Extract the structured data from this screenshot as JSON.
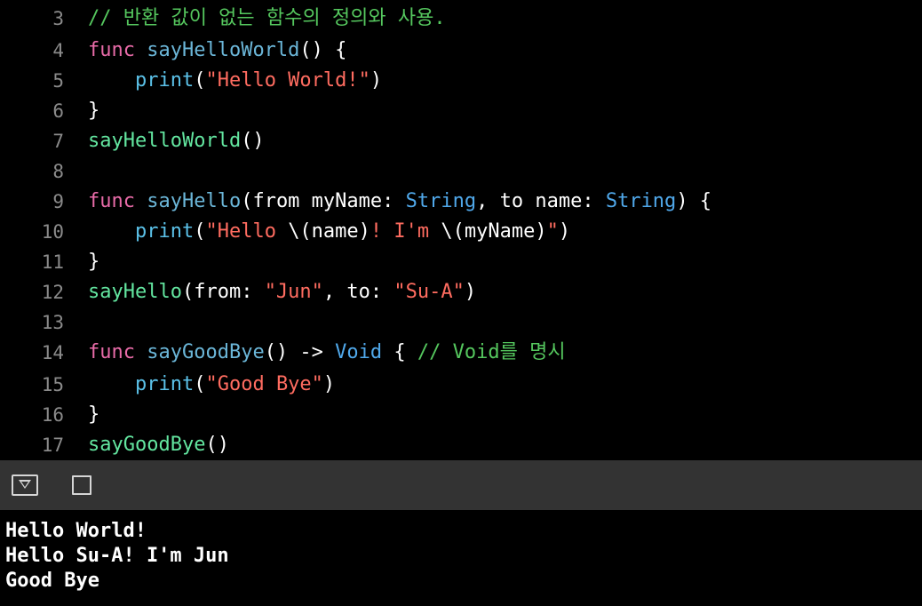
{
  "editor": {
    "lines": [
      {
        "number": "3",
        "tokens": [
          {
            "t": "// 반환 값이 없는 함수의 정의와 사용.",
            "k": "comment"
          }
        ]
      },
      {
        "number": "4",
        "tokens": [
          {
            "t": "func",
            "k": "keyword"
          },
          {
            "t": " ",
            "k": "plain"
          },
          {
            "t": "sayHelloWorld",
            "k": "decl"
          },
          {
            "t": "() {",
            "k": "plain"
          }
        ]
      },
      {
        "number": "5",
        "tokens": [
          {
            "t": "    ",
            "k": "plain"
          },
          {
            "t": "print",
            "k": "call"
          },
          {
            "t": "(",
            "k": "plain"
          },
          {
            "t": "\"Hello World!\"",
            "k": "string"
          },
          {
            "t": ")",
            "k": "plain"
          }
        ]
      },
      {
        "number": "6",
        "tokens": [
          {
            "t": "}",
            "k": "plain"
          }
        ]
      },
      {
        "number": "7",
        "tokens": [
          {
            "t": "sayHelloWorld",
            "k": "fn"
          },
          {
            "t": "()",
            "k": "plain"
          }
        ]
      },
      {
        "number": "8",
        "tokens": []
      },
      {
        "number": "9",
        "tokens": [
          {
            "t": "func",
            "k": "keyword"
          },
          {
            "t": " ",
            "k": "plain"
          },
          {
            "t": "sayHello",
            "k": "decl"
          },
          {
            "t": "(from myName: ",
            "k": "plain"
          },
          {
            "t": "String",
            "k": "type"
          },
          {
            "t": ", to name: ",
            "k": "plain"
          },
          {
            "t": "String",
            "k": "type"
          },
          {
            "t": ") {",
            "k": "plain"
          }
        ]
      },
      {
        "number": "10",
        "tokens": [
          {
            "t": "    ",
            "k": "plain"
          },
          {
            "t": "print",
            "k": "call"
          },
          {
            "t": "(",
            "k": "plain"
          },
          {
            "t": "\"Hello ",
            "k": "string"
          },
          {
            "t": "\\(name)",
            "k": "plain"
          },
          {
            "t": "! I'm ",
            "k": "string"
          },
          {
            "t": "\\(myName)",
            "k": "plain"
          },
          {
            "t": "\"",
            "k": "string"
          },
          {
            "t": ")",
            "k": "plain"
          }
        ]
      },
      {
        "number": "11",
        "tokens": [
          {
            "t": "}",
            "k": "plain"
          }
        ]
      },
      {
        "number": "12",
        "tokens": [
          {
            "t": "sayHello",
            "k": "fn"
          },
          {
            "t": "(from: ",
            "k": "plain"
          },
          {
            "t": "\"Jun\"",
            "k": "string"
          },
          {
            "t": ", to: ",
            "k": "plain"
          },
          {
            "t": "\"Su-A\"",
            "k": "string"
          },
          {
            "t": ")",
            "k": "plain"
          }
        ]
      },
      {
        "number": "13",
        "tokens": []
      },
      {
        "number": "14",
        "tokens": [
          {
            "t": "func",
            "k": "keyword"
          },
          {
            "t": " ",
            "k": "plain"
          },
          {
            "t": "sayGoodBye",
            "k": "decl"
          },
          {
            "t": "() -> ",
            "k": "plain"
          },
          {
            "t": "Void",
            "k": "type"
          },
          {
            "t": " { ",
            "k": "plain"
          },
          {
            "t": "// Void를 명시",
            "k": "comment"
          }
        ]
      },
      {
        "number": "15",
        "tokens": [
          {
            "t": "    ",
            "k": "plain"
          },
          {
            "t": "print",
            "k": "call"
          },
          {
            "t": "(",
            "k": "plain"
          },
          {
            "t": "\"Good Bye\"",
            "k": "string"
          },
          {
            "t": ")",
            "k": "plain"
          }
        ]
      },
      {
        "number": "16",
        "tokens": [
          {
            "t": "}",
            "k": "plain"
          }
        ]
      },
      {
        "number": "17",
        "tokens": [
          {
            "t": "sayGoodBye",
            "k": "fn"
          },
          {
            "t": "()",
            "k": "plain"
          }
        ]
      }
    ]
  },
  "toolbar": {
    "hide_console_icon": "hide-debug-area-icon",
    "clear_console_icon": "clear-console-icon"
  },
  "console": {
    "lines": [
      "Hello World!",
      "Hello Su-A! I'm Jun",
      "Good Bye"
    ]
  },
  "colors": {
    "keyword": "#e86ba8",
    "declaration": "#6bb6d8",
    "call": "#5bc1e8",
    "string": "#ff6c60",
    "type": "#50a8ea",
    "function_use": "#63e6a0",
    "comment": "#55c75e",
    "plain": "#ffffff",
    "toolbar_background": "#333333",
    "background": "#000000"
  }
}
